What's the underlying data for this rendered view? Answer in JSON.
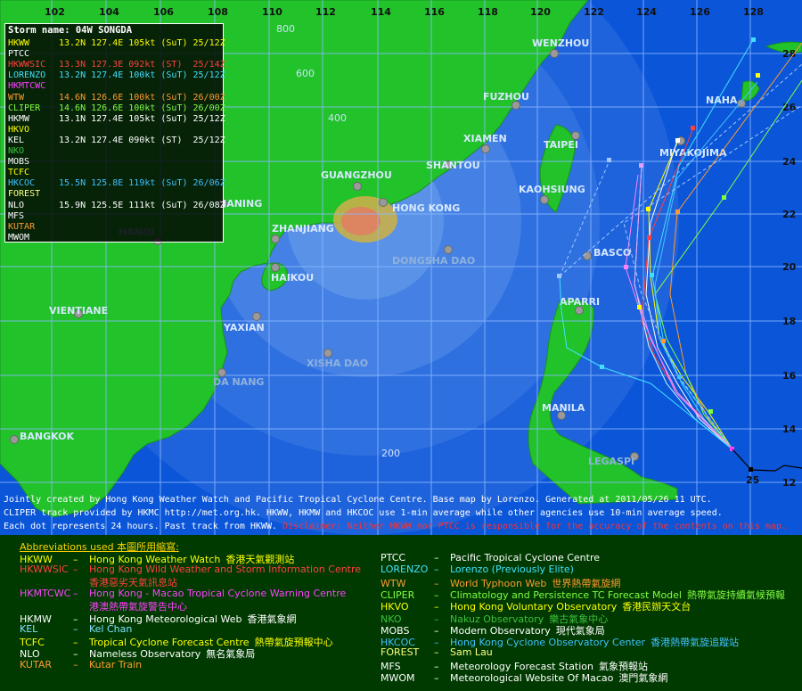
{
  "map": {
    "longitude_ticks": [
      "102",
      "104",
      "106",
      "108",
      "110",
      "112",
      "114",
      "116",
      "118",
      "120",
      "122",
      "124",
      "126",
      "128"
    ],
    "latitude_ticks": [
      "28",
      "26",
      "24",
      "22",
      "20",
      "18",
      "16",
      "14",
      "12"
    ],
    "range_rings_km": [
      "200",
      "400",
      "600",
      "800"
    ],
    "places": [
      "WENZHOU",
      "FUZHOU",
      "XIAMEN",
      "TAIPEI",
      "MIYAKOJIMA",
      "NAHA",
      "GUANGZHOU",
      "SHANTOU",
      "KAOHSIUNG",
      "HONG KONG",
      "NANING",
      "ZHANJIANG",
      "HANOI",
      "HAIKOU",
      "DONGSHA DAO",
      "BASCO",
      "VIENTIANE",
      "YAXIAN",
      "APARRI",
      "XISHA DAO",
      "DA NANG",
      "MANILA",
      "BANGKOK",
      "LEGASPI"
    ],
    "track_end_label": "25",
    "colors": {
      "sea": "#0a55d8",
      "land": "#22c22a",
      "grid": "#7fb3ff",
      "observed_track": "#000000"
    }
  },
  "info_panel": {
    "title": "Storm name: 04W SONGDA",
    "rows": [
      {
        "agency": "HKWW",
        "data": "13.2N 127.4E 105kt (SuT) 25/12Z",
        "color": "#ffff00"
      },
      {
        "agency": "PTCC",
        "data": "",
        "color": "#ffffff"
      },
      {
        "agency": "HKWWSIC",
        "data": "13.3N 127.3E 092kt (ST)  25/14Z",
        "color": "#ff4040"
      },
      {
        "agency": "LORENZO",
        "data": "13.2N 127.4E 100kt (SuT) 25/12Z",
        "color": "#40e0ff"
      },
      {
        "agency": "HKMTCWC",
        "data": "",
        "color": "#ff40ff"
      },
      {
        "agency": "WTW",
        "data": "14.6N 126.6E 100kt (SuT) 26/00Z",
        "color": "#ff9a30"
      },
      {
        "agency": "CLIPER",
        "data": "14.6N 126.6E 100kt (SuT) 26/00Z",
        "color": "#80ff40"
      },
      {
        "agency": "HKMW",
        "data": "13.1N 127.4E 105kt (SuT) 25/12Z",
        "color": "#ffffff"
      },
      {
        "agency": "HKVO",
        "data": "",
        "color": "#ffff00"
      },
      {
        "agency": "KEL",
        "data": "13.2N 127.4E 090kt (ST)  25/12Z",
        "color": "#ffffff"
      },
      {
        "agency": "NKO",
        "data": "",
        "color": "#40c040"
      },
      {
        "agency": "MOBS",
        "data": "",
        "color": "#ffffff"
      },
      {
        "agency": "TCFC",
        "data": "",
        "color": "#ffff00"
      },
      {
        "agency": "HKCOC",
        "data": "15.5N 125.8E 119kt (SuT) 26/06Z",
        "color": "#40c0ff"
      },
      {
        "agency": "FOREST",
        "data": "",
        "color": "#ffff80"
      },
      {
        "agency": "NLO",
        "data": "15.9N 125.5E 111kt (SuT) 26/08Z",
        "color": "#ffffff"
      },
      {
        "agency": "MFS",
        "data": "",
        "color": "#ffffff"
      },
      {
        "agency": "KUTAR",
        "data": "",
        "color": "#ff9a30"
      },
      {
        "agency": "MWOM",
        "data": "",
        "color": "#ffffff"
      }
    ]
  },
  "notes": {
    "line1": "Jointly created by Hong Kong Weather Watch and Pacific Tropical Cyclone Centre. Base map by Lorenzo. Generated at 2011/05/26 11 UTC.",
    "line2": "CLIPER track provided by HKMC http://met.org.hk. HKWW, HKMW and HKCOC use 1-min average while other agencies use 10-min average speed.",
    "line3a": "Each dot represents 24 hours. Past track from HKWW.",
    "line3b": "Disclaimer: Neither HKWW nor PTCC is responsible for the accuracy of the contents on this map."
  },
  "legend": {
    "header": "Abbreviations used 本圖所用縮寫:",
    "left": [
      {
        "abbr": "HKWW",
        "name": "Hong Kong Weather Watch",
        "chinese": "香港天氣觀測站",
        "color": "#ffff00"
      },
      {
        "abbr": "HKWWSIC",
        "name": "Hong Kong Wild Weather and Storm Information Centre",
        "chinese": "香港惡劣天氣訊息站",
        "color": "#ff4040"
      },
      {
        "abbr": "HKMTCWC",
        "name": "Hong Kong - Macao Tropical Cyclone Warning Centre",
        "chinese": "港澳熱帶氣旋警告中心",
        "color": "#ff40ff"
      },
      {
        "abbr": "HKMW",
        "name": "Hong Kong Meteorological Web",
        "chinese": "香港氣象網",
        "color": "#ffffff"
      },
      {
        "abbr": "KEL",
        "name": "Kel Chan",
        "chinese": "",
        "color": "#80e0ff"
      },
      {
        "abbr": "TCFC",
        "name": "Tropical Cyclone Forecast Centre",
        "chinese": "熱帶氣旋預報中心",
        "color": "#ffff00"
      },
      {
        "abbr": "NLO",
        "name": "Nameless Observatory",
        "chinese": "無名氣象局",
        "color": "#ffffff"
      },
      {
        "abbr": "KUTAR",
        "name": "Kutar Train",
        "chinese": "",
        "color": "#ff9a30"
      }
    ],
    "right": [
      {
        "abbr": "PTCC",
        "name": "Pacific Tropical Cyclone Centre",
        "chinese": "",
        "color": "#ffffff"
      },
      {
        "abbr": "LORENZO",
        "name": "Lorenzo (Previously Elite)",
        "chinese": "",
        "color": "#40e0ff"
      },
      {
        "abbr": "WTW",
        "name": "World Typhoon Web",
        "chinese": "世界熱帶氣旋網",
        "color": "#ff9a30"
      },
      {
        "abbr": "CLIPER",
        "name": "Climatology and Persistence TC Forecast Model",
        "chinese": "熱帶氣旋持續氣候預報",
        "color": "#80ff40"
      },
      {
        "abbr": "HKVO",
        "name": "Hong Kong Voluntary Observatory",
        "chinese": "香港民辦天文台",
        "color": "#ffff00"
      },
      {
        "abbr": "NKO",
        "name": "Nakuz Observatory",
        "chinese": "樂古氣象中心",
        "color": "#40c040"
      },
      {
        "abbr": "MOBS",
        "name": "Modern Observatory",
        "chinese": "現代氣象局",
        "color": "#ffffff"
      },
      {
        "abbr": "HKCOC",
        "name": "Hong Kong Cyclone Observatory Center",
        "chinese": "香港熱帶氣旋追蹤站",
        "color": "#40c0ff"
      },
      {
        "abbr": "FOREST",
        "name": "Sam Lau",
        "chinese": "",
        "color": "#ffff80"
      },
      {
        "abbr": "MFS",
        "name": "Meteorology Forecast Station",
        "chinese": "氣象預報站",
        "color": "#ffffff"
      },
      {
        "abbr": "MWOM",
        "name": "Meteorological Website Of Macao",
        "chinese": "澳門氣象網",
        "color": "#ffffff"
      }
    ]
  }
}
